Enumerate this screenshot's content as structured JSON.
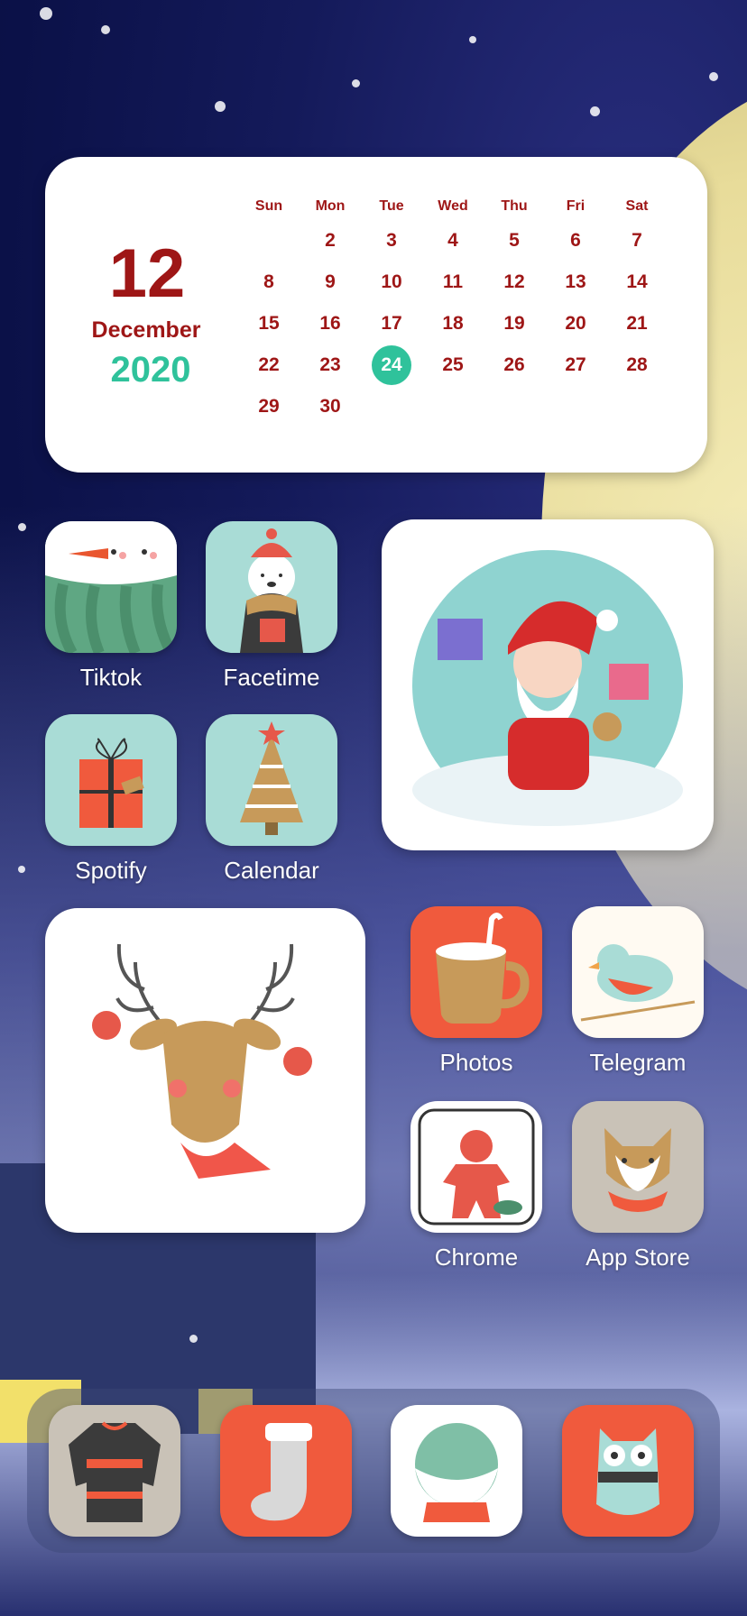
{
  "calendar": {
    "day": "12",
    "month": "December",
    "year": "2020",
    "weekdays": [
      "Sun",
      "Mon",
      "Tue",
      "Wed",
      "Thu",
      "Fri",
      "Sat"
    ],
    "weeks": [
      [
        "",
        "2",
        "3",
        "4",
        "5",
        "6",
        "7"
      ],
      [
        "8",
        "9",
        "10",
        "11",
        "12",
        "13",
        "14"
      ],
      [
        "15",
        "16",
        "17",
        "18",
        "19",
        "20",
        "21"
      ],
      [
        "22",
        "23",
        "24",
        "25",
        "26",
        "27",
        "28"
      ],
      [
        "29",
        "30",
        "",
        "",
        "",
        "",
        ""
      ]
    ],
    "highlighted": "24",
    "colors": {
      "text": "#9e1616",
      "accent": "#2fc29b"
    }
  },
  "apps": {
    "tiktok": "Tiktok",
    "facetime": "Facetime",
    "spotify": "Spotify",
    "calendar": "Calendar",
    "photos": "Photos",
    "telegram": "Telegram",
    "chrome": "Chrome",
    "appstore": "App Store"
  },
  "widgets": {
    "santa": "santa-illustration",
    "reindeer": "reindeer-illustration"
  },
  "dock": [
    "sweater-icon",
    "stocking-icon",
    "snowglobe-icon",
    "owl-icon"
  ]
}
